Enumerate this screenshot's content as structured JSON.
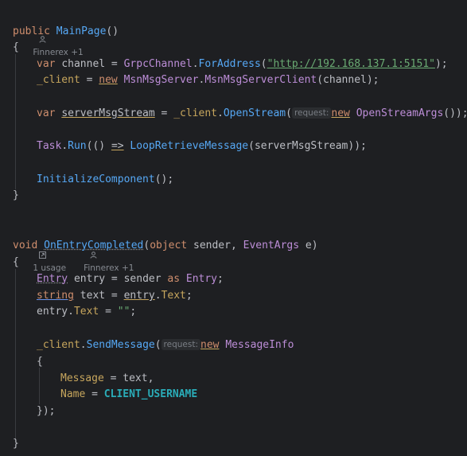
{
  "hints": {
    "mainpage": {
      "author": "Finnerex +1"
    },
    "onentry": {
      "usages": "1 usage",
      "author": "Finnerex +1"
    }
  },
  "code": {
    "l_public": "public",
    "l_mainpage": "MainPage",
    "l_parens": "()",
    "open_brace": "{",
    "close_brace": "}",
    "var": "var",
    "channel": "channel",
    "eq": " = ",
    "grpc": "GrpcChannel",
    "foraddress": "ForAddress",
    "url": "\"http://192.168.137.1:5151\"",
    "client_field": "_client",
    "new": "new",
    "msnserver": "MsnMsgServer",
    "msnclient": "MsnMsgServerClient",
    "channel_arg": "(channel);",
    "servermsgstream": "serverMsgStream",
    "openstream": "OpenStream",
    "inlay_request": "request:",
    "openstreamargs": "OpenStreamArgs",
    "openstream_tail": "());",
    "task": "Task",
    "run": "Run",
    "lambda": "(() => ",
    "loopretrieve": "LoopRetrieveMessage",
    "loop_tail": "(serverMsgStream));",
    "initcomp": "InitializeComponent",
    "init_tail": "();",
    "void": "void",
    "onentrycompleted": "OnEntryCompleted",
    "object": "object",
    "sender": "sender",
    "eventargs": "EventArgs",
    "e_param": "e)",
    "entry_type": "Entry",
    "entry_var": "entry",
    "as": "as",
    "string": "string",
    "text_var": "text",
    "text_prop": "Text",
    "empty_str": "\"\"",
    "sendmessage": "SendMessage",
    "messageinfo": "MessageInfo",
    "message_prop": "Message",
    "name_prop": "Name",
    "client_username": "CLIENT_USERNAME",
    "close_call": "});"
  },
  "colors": {
    "background": "#1e1f22",
    "keyword": "#cf8e6d",
    "method": "#56a8f5",
    "string": "#6aab73",
    "field": "#c7a65d"
  }
}
